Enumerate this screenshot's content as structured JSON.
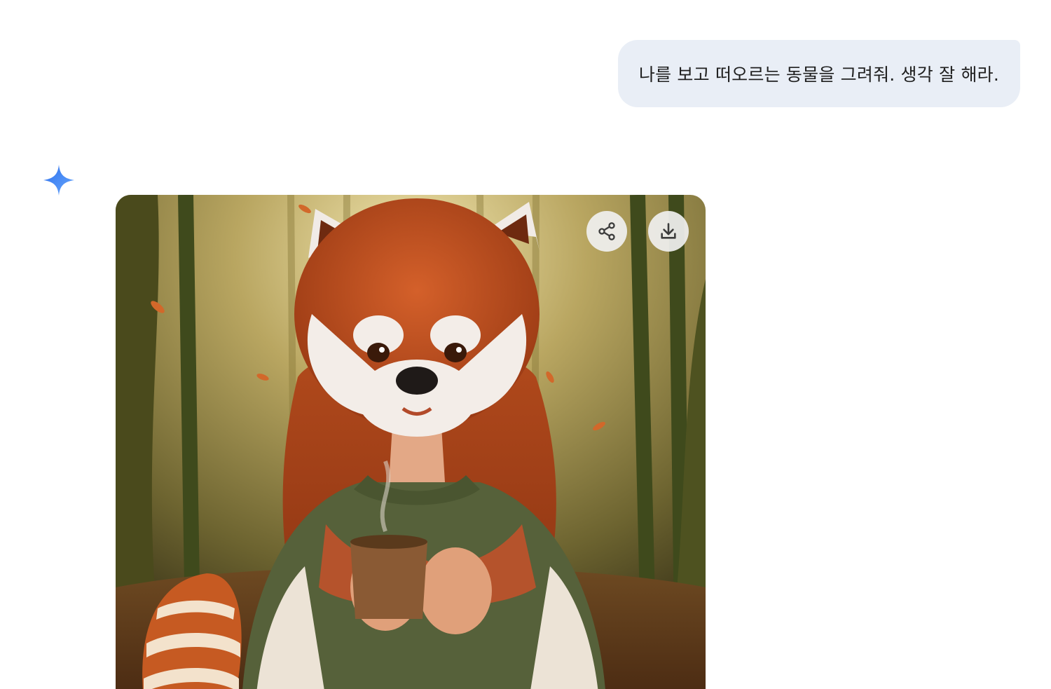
{
  "conversation": {
    "user_message": "나를 보고 떠오르는 동물을 그려줘. 생각 잘 해라.",
    "assistant": {
      "avatar_icon": "gemini-sparkle-icon",
      "generated_image": {
        "actions": [
          {
            "name": "share",
            "icon": "share-icon"
          },
          {
            "name": "download",
            "icon": "download-icon"
          }
        ]
      }
    }
  },
  "colors": {
    "bubble_bg": "#e9eef6",
    "sparkle_blue": "#4285f4"
  }
}
